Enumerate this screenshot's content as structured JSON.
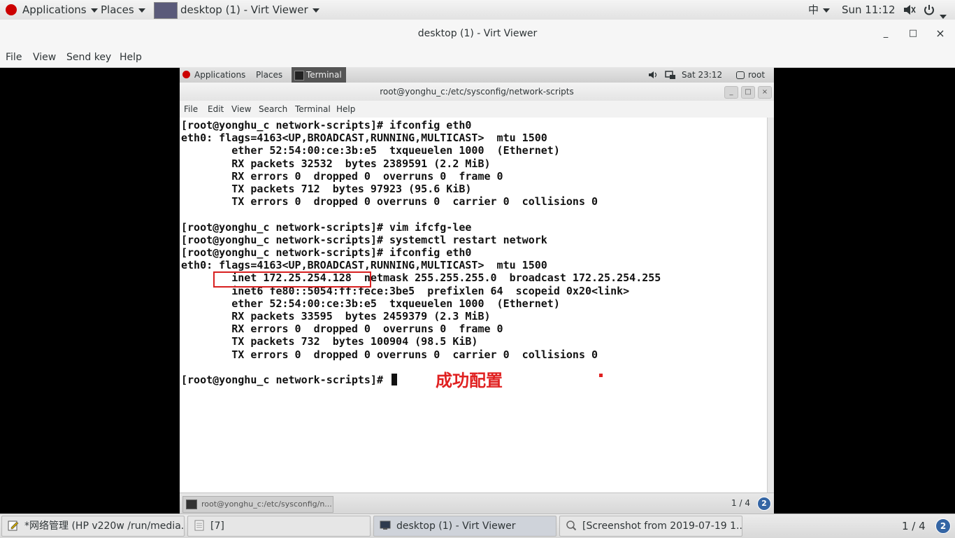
{
  "host_panel": {
    "applications": "Applications",
    "places": "Places",
    "window_title": "desktop (1) - Virt Viewer",
    "input_method": "中",
    "clock": "Sun 11:12"
  },
  "viewer_window": {
    "title": "desktop (1) - Virt Viewer",
    "minimize": "_",
    "maximize": "□",
    "close": "×",
    "menu": [
      "File",
      "View",
      "Send key",
      "Help"
    ]
  },
  "guest": {
    "panel": {
      "applications": "Applications",
      "places": "Places",
      "terminal": "Terminal",
      "clock": "Sat 23:12",
      "user": "root"
    },
    "terminal_window": {
      "title": "root@yonghu_c:/etc/sysconfig/network-scripts",
      "menu": [
        "File",
        "Edit",
        "View",
        "Search",
        "Terminal",
        "Help"
      ],
      "lines": [
        "[root@yonghu_c network-scripts]# ifconfig eth0",
        "eth0: flags=4163<UP,BROADCAST,RUNNING,MULTICAST>  mtu 1500",
        "        ether 52:54:00:ce:3b:e5  txqueuelen 1000  (Ethernet)",
        "        RX packets 32532  bytes 2389591 (2.2 MiB)",
        "        RX errors 0  dropped 0  overruns 0  frame 0",
        "        TX packets 712  bytes 97923 (95.6 KiB)",
        "        TX errors 0  dropped 0 overruns 0  carrier 0  collisions 0",
        "",
        "[root@yonghu_c network-scripts]# vim ifcfg-lee",
        "[root@yonghu_c network-scripts]# systemctl restart network",
        "[root@yonghu_c network-scripts]# ifconfig eth0",
        "eth0: flags=4163<UP,BROADCAST,RUNNING,MULTICAST>  mtu 1500",
        "        inet 172.25.254.128  netmask 255.255.255.0  broadcast 172.25.254.255",
        "        inet6 fe80::5054:ff:fece:3be5  prefixlen 64  scopeid 0x20<link>",
        "        ether 52:54:00:ce:3b:e5  txqueuelen 1000  (Ethernet)",
        "        RX packets 33595  bytes 2459379 (2.3 MiB)",
        "        RX errors 0  dropped 0  overruns 0  frame 0",
        "        TX packets 732  bytes 100904 (98.5 KiB)",
        "        TX errors 0  dropped 0 overruns 0  carrier 0  collisions 0",
        "",
        "[root@yonghu_c network-scripts]# "
      ],
      "annotation": "成功配置"
    },
    "taskbar": {
      "task": "root@yonghu_c:/etc/sysconfig/n...",
      "pager": "1 / 4"
    }
  },
  "host_taskbar": {
    "tasks": [
      "*网络管理 (HP v220w /run/media...",
      "[7]",
      "desktop (1) - Virt Viewer",
      "[Screenshot from 2019-07-19 1..."
    ],
    "pager": "1 / 4"
  },
  "colors": {
    "annotation": "#e02020",
    "terminal_bg": "#ffffff"
  }
}
